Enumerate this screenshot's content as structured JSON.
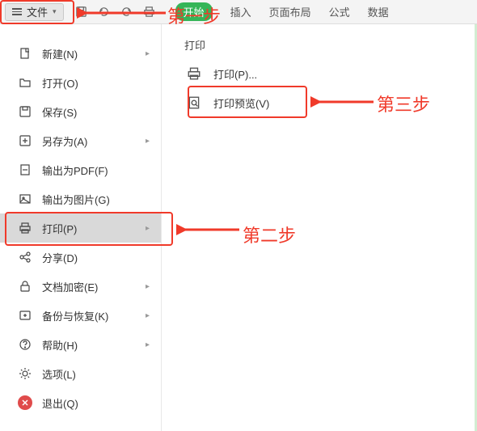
{
  "toolbar": {
    "file_label": "文件",
    "tabs": {
      "start": "开始",
      "insert": "插入",
      "layout": "页面布局",
      "formula": "公式",
      "data": "数据"
    }
  },
  "sidebar": {
    "items": [
      {
        "label": "新建(N)",
        "has_arrow": true
      },
      {
        "label": "打开(O)",
        "has_arrow": false
      },
      {
        "label": "保存(S)",
        "has_arrow": false
      },
      {
        "label": "另存为(A)",
        "has_arrow": true
      },
      {
        "label": "输出为PDF(F)",
        "has_arrow": false
      },
      {
        "label": "输出为图片(G)",
        "has_arrow": false
      },
      {
        "label": "打印(P)",
        "has_arrow": true
      },
      {
        "label": "分享(D)",
        "has_arrow": false
      },
      {
        "label": "文档加密(E)",
        "has_arrow": true
      },
      {
        "label": "备份与恢复(K)",
        "has_arrow": true
      },
      {
        "label": "帮助(H)",
        "has_arrow": true
      },
      {
        "label": "选项(L)",
        "has_arrow": false
      },
      {
        "label": "退出(Q)",
        "has_arrow": false
      }
    ]
  },
  "submenu": {
    "title": "打印",
    "print": "打印(P)...",
    "preview": "打印预览(V)"
  },
  "annotations": {
    "step1": "第一步",
    "step2": "第二步",
    "step3": "第三步"
  },
  "colors": {
    "accent_green": "#35b558",
    "annotation_red": "#f03a2a"
  }
}
